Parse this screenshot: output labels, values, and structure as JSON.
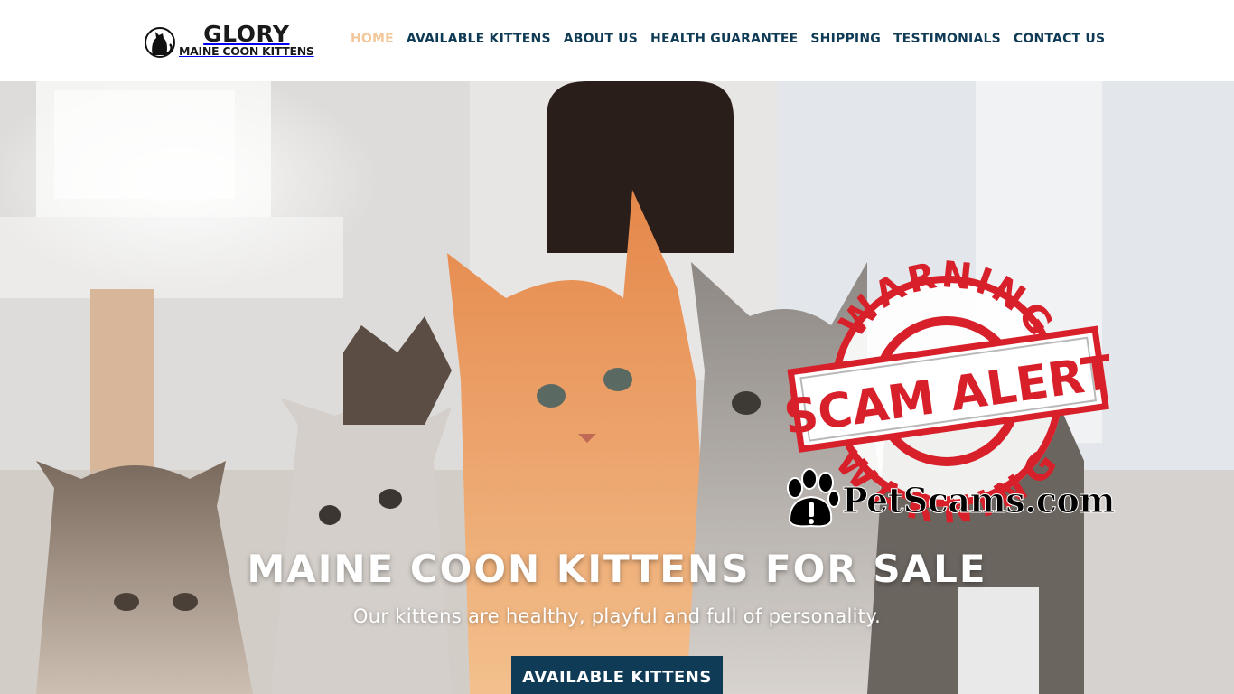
{
  "brand": {
    "title": "GLORY",
    "subtitle": "MAINE COON KITTENS"
  },
  "nav": {
    "items": [
      {
        "label": "HOME",
        "active": true
      },
      {
        "label": "AVAILABLE KITTENS",
        "active": false
      },
      {
        "label": "ABOUT US",
        "active": false
      },
      {
        "label": "HEALTH GUARANTEE",
        "active": false
      },
      {
        "label": "SHIPPING",
        "active": false
      },
      {
        "label": "TESTIMONIALS",
        "active": false
      },
      {
        "label": "CONTACT US",
        "active": false
      }
    ]
  },
  "hero": {
    "title": "MAINE COON KITTENS FOR SALE",
    "subtitle": "Our kittens are healthy, playful and full of personality.",
    "button_label": "AVAILABLE KITTENS"
  },
  "watermark": {
    "stamp_top": "WARNING",
    "stamp_middle": "SCAM ALERT",
    "stamp_bottom": "WARNING",
    "site": "PetScams.com"
  },
  "colors": {
    "nav_text": "#0f3b56",
    "nav_active": "#f2c79a",
    "button_bg": "#0f3b56",
    "stamp_red": "#d8202a"
  },
  "icons": {
    "logo": "cat-silhouette-icon",
    "paw": "paw-warning-icon"
  }
}
